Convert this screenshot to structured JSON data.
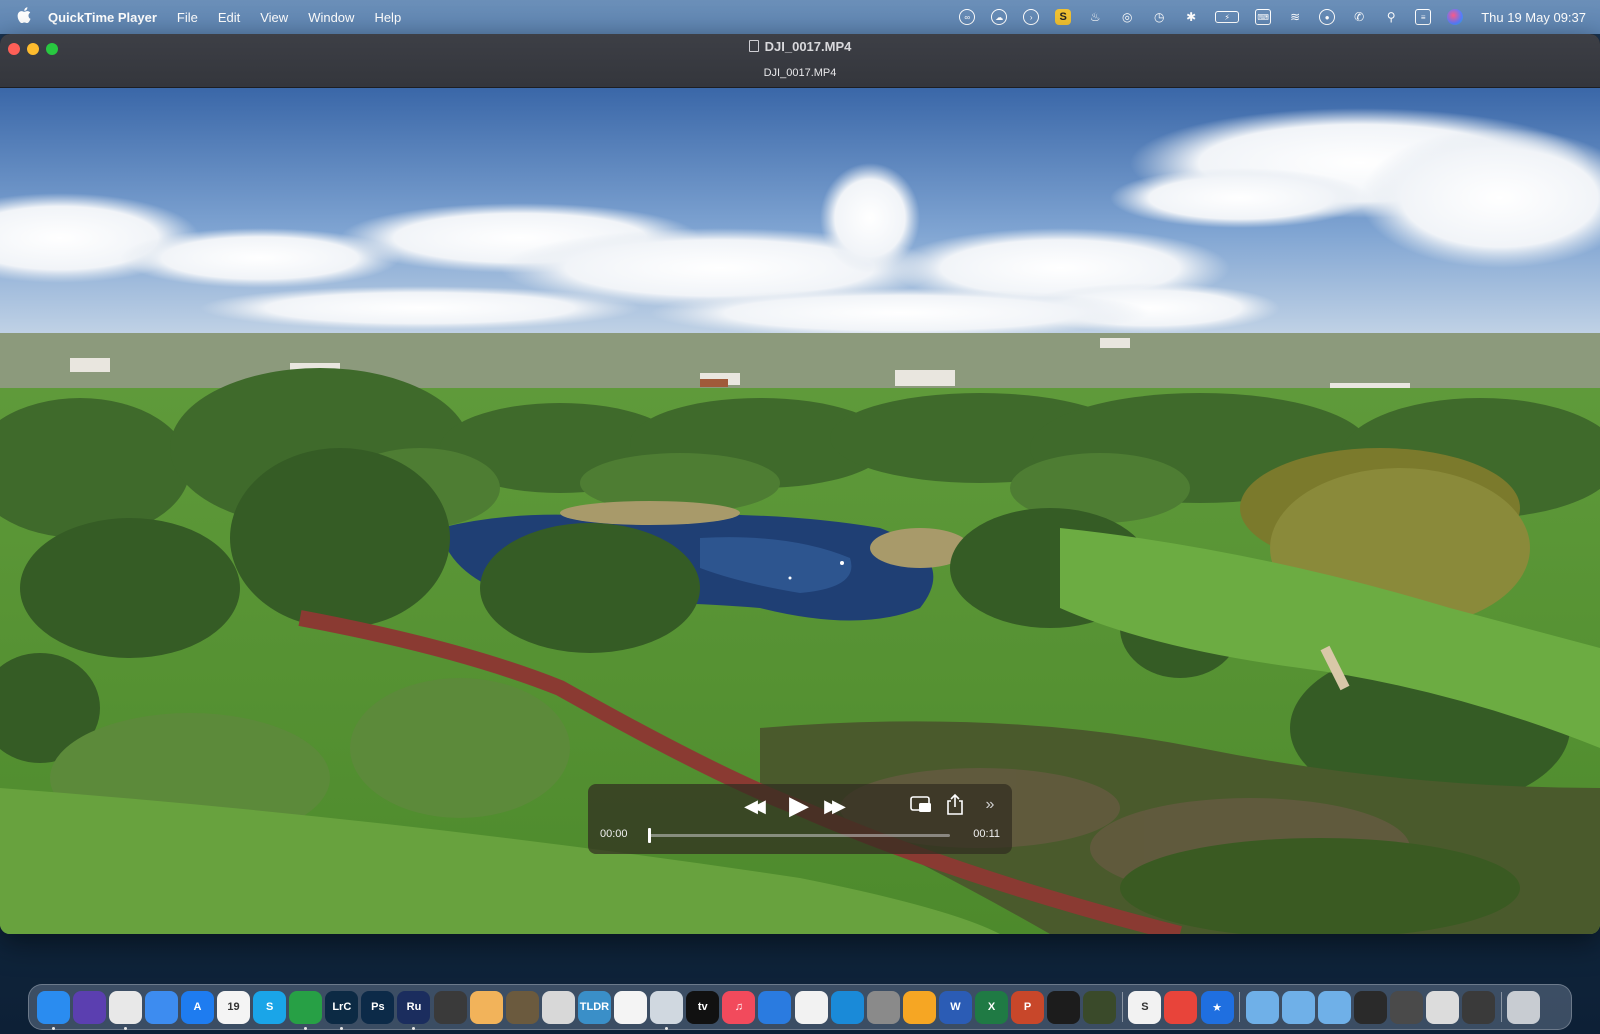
{
  "menubar": {
    "app_name": "QuickTime Player",
    "menus": [
      "File",
      "Edit",
      "View",
      "Window",
      "Help"
    ],
    "clock": "Thu 19 May  09:37",
    "status_icons": [
      "creative-cloud-icon",
      "cloud-drive-icon",
      "media-icon",
      "s-app-icon",
      "flame-icon",
      "airdrop-icon",
      "time-machine-icon",
      "bluetooth-icon",
      "battery-icon",
      "keyboard-icon",
      "wifi-icon",
      "user-icon",
      "phone-icon",
      "search-icon",
      "control-center-icon",
      "siri-icon"
    ]
  },
  "window": {
    "title": "DJI_0017.MP4",
    "subtitle": "DJI_0017.MP4"
  },
  "player": {
    "current_time": "00:00",
    "duration": "00:11",
    "progress": 0.0,
    "rewind_glyph": "◀◀",
    "play_glyph": "▶",
    "ffwd_glyph": "▶▶",
    "more_glyph": "»"
  },
  "dock": {
    "apps": [
      {
        "name": "finder",
        "label": "",
        "color": "#2a8cf0",
        "running": true
      },
      {
        "name": "siri",
        "label": "",
        "color": "#5b3fb0",
        "running": false
      },
      {
        "name": "chrome",
        "label": "",
        "color": "#e8e8e8",
        "running": true
      },
      {
        "name": "safari",
        "label": "",
        "color": "#3d8cf0",
        "running": false
      },
      {
        "name": "app-store",
        "label": "A",
        "color": "#1e7cf0",
        "running": false
      },
      {
        "name": "calendar",
        "label": "19",
        "color": "#f4f4f4",
        "running": false
      },
      {
        "name": "skype",
        "label": "S",
        "color": "#1aa5e8",
        "running": false
      },
      {
        "name": "vpn",
        "label": "",
        "color": "#27a045",
        "running": true
      },
      {
        "name": "lightroom-classic",
        "label": "LrC",
        "color": "#0c2a44",
        "running": true
      },
      {
        "name": "photoshop",
        "label": "Ps",
        "color": "#0c2a48",
        "running": false
      },
      {
        "name": "rush",
        "label": "Ru",
        "color": "#1b2d5e",
        "running": true
      },
      {
        "name": "image-viewer",
        "label": "",
        "color": "#3a3a3a",
        "running": false
      },
      {
        "name": "pencil",
        "label": "",
        "color": "#f2b35a",
        "running": false
      },
      {
        "name": "photo-app",
        "label": "",
        "color": "#6b5a3e",
        "running": false
      },
      {
        "name": "compass",
        "label": "",
        "color": "#d8d8d8",
        "running": false
      },
      {
        "name": "tldr",
        "label": "TLDR",
        "color": "#3a8fc8",
        "running": false
      },
      {
        "name": "photos",
        "label": "",
        "color": "#f4f4f4",
        "running": false
      },
      {
        "name": "quicktime",
        "label": "",
        "color": "#d0d8e0",
        "running": true
      },
      {
        "name": "apple-tv",
        "label": "tv",
        "color": "#111111",
        "running": false
      },
      {
        "name": "music",
        "label": "♫",
        "color": "#f24a5c",
        "running": false
      },
      {
        "name": "audio-app",
        "label": "",
        "color": "#2a7be0",
        "running": false
      },
      {
        "name": "cube-app",
        "label": "",
        "color": "#f2f2f2",
        "running": false
      },
      {
        "name": "circle-app",
        "label": "",
        "color": "#1a8ad8",
        "running": false
      },
      {
        "name": "system-preferences",
        "label": "",
        "color": "#8a8a8a",
        "running": false
      },
      {
        "name": "sketch-app",
        "label": "",
        "color": "#f6a623",
        "running": false
      },
      {
        "name": "word",
        "label": "W",
        "color": "#2b5cb5",
        "running": false
      },
      {
        "name": "excel",
        "label": "X",
        "color": "#1f7a44",
        "running": false
      },
      {
        "name": "powerpoint",
        "label": "P",
        "color": "#c8472a",
        "running": false
      },
      {
        "name": "activity-monitor",
        "label": "",
        "color": "#1c1c1c",
        "running": false
      },
      {
        "name": "battery-app",
        "label": "",
        "color": "#3a4a2a",
        "running": false
      },
      {
        "name": "s-app",
        "label": "S",
        "color": "#f2f2f2",
        "running": false
      },
      {
        "name": "creative-cloud",
        "label": "",
        "color": "#e8443a",
        "running": false
      },
      {
        "name": "reeder",
        "label": "★",
        "color": "#1f6fe0",
        "running": false
      },
      {
        "name": "downloads-folder",
        "label": "",
        "color": "#6fb0e8",
        "running": false
      },
      {
        "name": "apps-folder",
        "label": "",
        "color": "#6fb0e8",
        "running": false
      },
      {
        "name": "docs-folder",
        "label": "",
        "color": "#6fb0e8",
        "running": false
      },
      {
        "name": "window-thumb-1",
        "label": "",
        "color": "#2a2a2a",
        "running": false
      },
      {
        "name": "window-thumb-2",
        "label": "",
        "color": "#4a4a4a",
        "running": false
      },
      {
        "name": "window-thumb-3",
        "label": "",
        "color": "#dcdcdc",
        "running": false
      },
      {
        "name": "window-thumb-4",
        "label": "",
        "color": "#3a3a3a",
        "running": false
      },
      {
        "name": "trash",
        "label": "",
        "color": "#c8ccd2",
        "running": false
      }
    ]
  }
}
